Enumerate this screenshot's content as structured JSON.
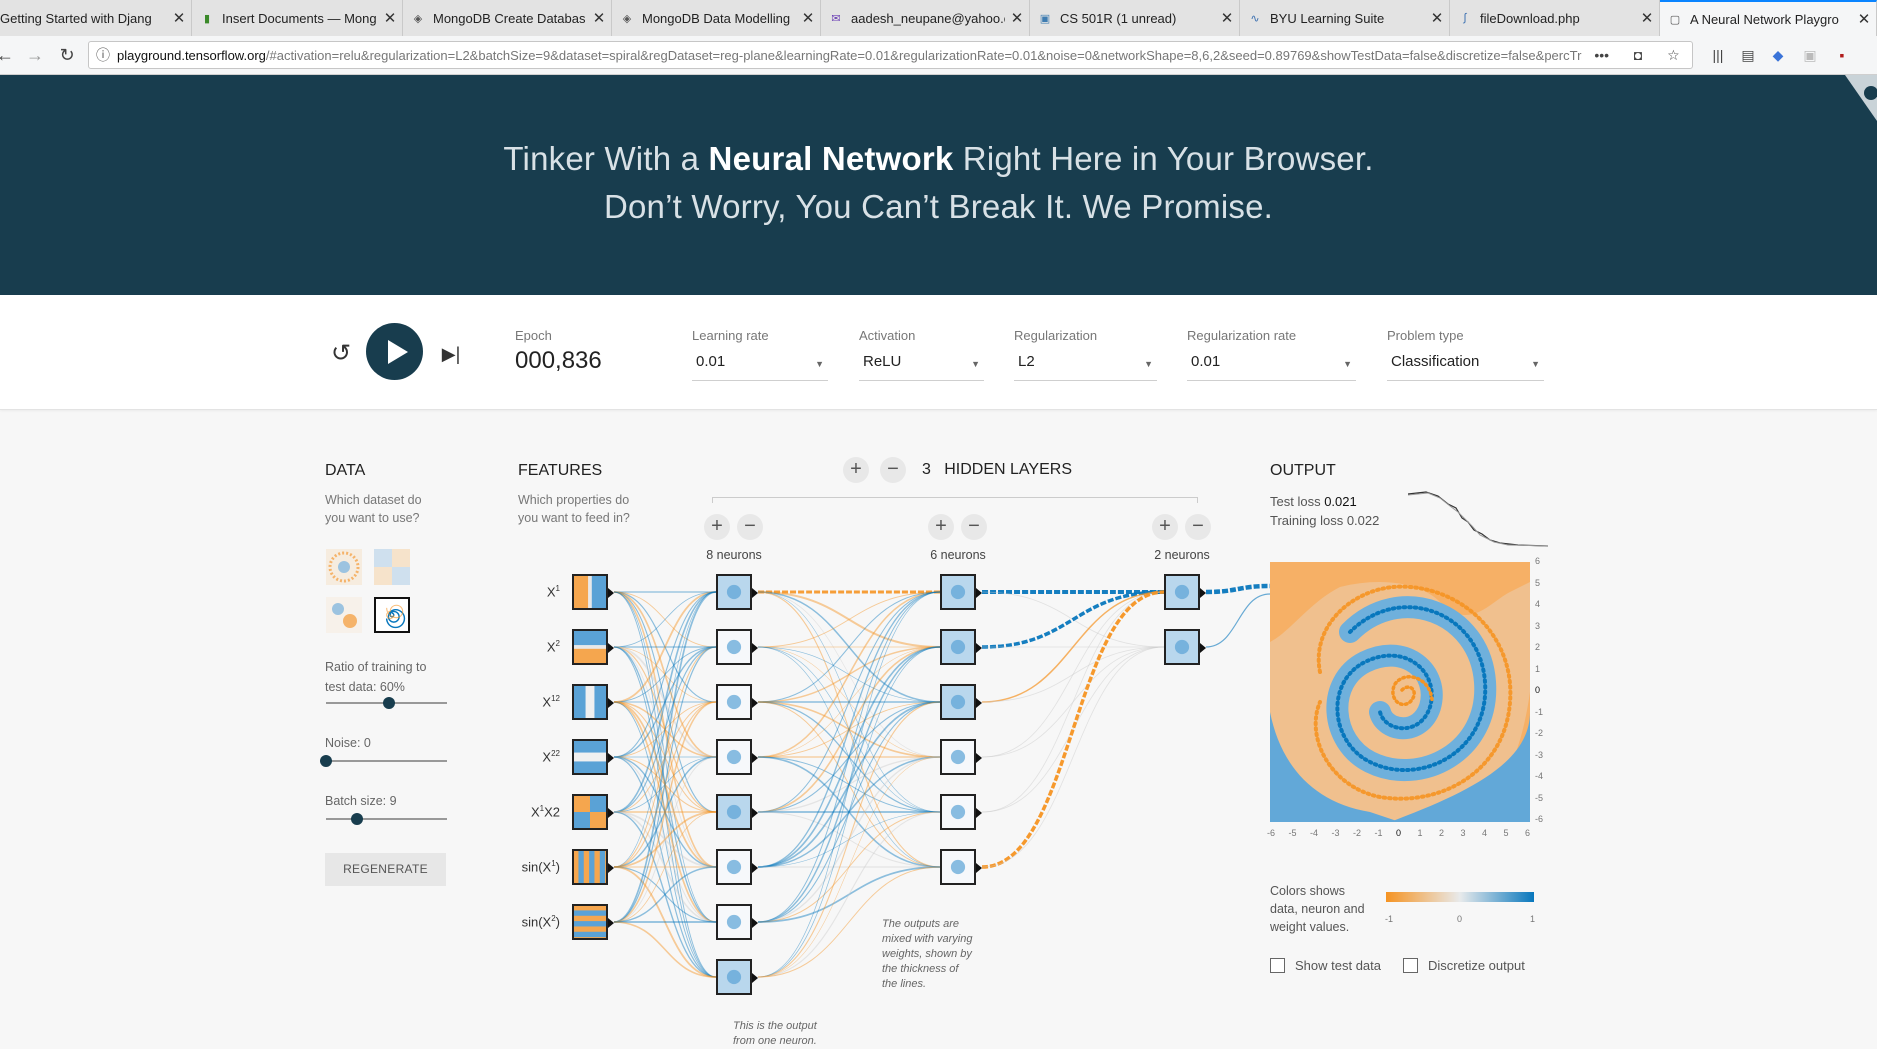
{
  "browser": {
    "tabs": [
      {
        "title": "Getting Started with Djang",
        "icon": "django-icon"
      },
      {
        "title": "Insert Documents — Mong",
        "icon": "mongodb-leaf-icon"
      },
      {
        "title": "MongoDB Create Databas",
        "icon": "diamond-icon"
      },
      {
        "title": "MongoDB Data Modelling",
        "icon": "diamond-icon"
      },
      {
        "title": "aadesh_neupane@yahoo.c",
        "icon": "mail-icon"
      },
      {
        "title": "CS 501R (1 unread)",
        "icon": "piazza-icon"
      },
      {
        "title": "BYU Learning Suite",
        "icon": "learning-suite-icon"
      },
      {
        "title": "fileDownload.php",
        "icon": "file-icon"
      },
      {
        "title": "A Neural Network Playgro",
        "icon": "tensorflow-icon"
      }
    ],
    "url_host": "playground.tensorflow.org",
    "url_rest": "/#activation=relu&regularization=L2&batchSize=9&dataset=spiral&regDataset=reg-plane&learningRate=0.01&regularizationRate=0.01&noise=0&networkShape=8,6,2&seed=0.89769&showTestData=false&discretize=false&percTrainD",
    "url_scheme_hidden": "",
    "more_label": "•••"
  },
  "header": {
    "line1_pre": "Tinker With a ",
    "line1_bold": "Neural Network",
    "line1_post": " Right Here in Your Browser.",
    "line2": "Don’t Worry, You Can’t Break It. We Promise."
  },
  "controls": {
    "epoch_label": "Epoch",
    "epoch_value": "000,836",
    "learning_rate_label": "Learning rate",
    "learning_rate_value": "0.01",
    "activation_label": "Activation",
    "activation_value": "ReLU",
    "regularization_label": "Regularization",
    "regularization_value": "L2",
    "regularization_rate_label": "Regularization rate",
    "regularization_rate_value": "0.01",
    "problem_type_label": "Problem type",
    "problem_type_value": "Classification"
  },
  "data_panel": {
    "title": "DATA",
    "desc_line1": "Which dataset do",
    "desc_line2": "you want to use?",
    "datasets": [
      "circle",
      "xor",
      "gaussian",
      "spiral"
    ],
    "selected_dataset": "spiral",
    "ratio_label_line1": "Ratio of training to",
    "ratio_label_line2": "test data:  60%",
    "ratio_value": 0.6,
    "noise_label": "Noise:  0",
    "noise_value": 0,
    "batch_label": "Batch size:  9",
    "batch_fraction": 0.26,
    "regenerate_label": "REGENERATE"
  },
  "features_panel": {
    "title": "FEATURES",
    "desc_line1": "Which properties do",
    "desc_line2": "you want to feed in?",
    "features": [
      {
        "base": "X",
        "sup": "1",
        "tail": "",
        "pattern": "x1"
      },
      {
        "base": "X",
        "sup": "2",
        "tail": "",
        "pattern": "x2"
      },
      {
        "base": "X",
        "sup": "12",
        "tail": "",
        "pattern": "x1sq"
      },
      {
        "base": "X",
        "sup": "22",
        "tail": "",
        "pattern": "x2sq"
      },
      {
        "base": "X",
        "sup": "1",
        "tail": "X2",
        "pattern": "x1x2"
      },
      {
        "base": "sin(X",
        "sup": "1",
        "tail": ")",
        "pattern": "sinx1"
      },
      {
        "base": "sin(X",
        "sup": "2",
        "tail": ")",
        "pattern": "sinx2"
      }
    ]
  },
  "network": {
    "hidden_layers_count": "3",
    "hidden_layers_label": "HIDDEN LAYERS",
    "layers": [
      {
        "neurons_label": "8 neurons",
        "neurons": 8
      },
      {
        "neurons_label": "6 neurons",
        "neurons": 6
      },
      {
        "neurons_label": "2 neurons",
        "neurons": 2
      }
    ],
    "plus_symbol": "+",
    "minus_symbol": "−",
    "note_mixed_l1": "The outputs are",
    "note_mixed_l2": "mixed with varying",
    "note_mixed_l3": "weights, shown by",
    "note_mixed_l4": "the thickness of",
    "note_mixed_l5": "the lines.",
    "note_output_l1": "This is the output",
    "note_output_l2": "from one neuron."
  },
  "output_panel": {
    "title": "OUTPUT",
    "test_loss_label": "Test loss ",
    "test_loss_value": "0.021",
    "training_loss_label": "Training loss ",
    "training_loss_value": "0.022",
    "y_ticks": [
      "6",
      "5",
      "4",
      "3",
      "2",
      "1",
      "0",
      "-1",
      "-2",
      "-3",
      "-4",
      "-5",
      "-6"
    ],
    "x_ticks": [
      "-6",
      "-5",
      "-4",
      "-3",
      "-2",
      "-1",
      "0",
      "1",
      "2",
      "3",
      "4",
      "5",
      "6"
    ],
    "legend_line1": "Colors shows",
    "legend_line2": "data, neuron and",
    "legend_line3": "weight values.",
    "legend_min": "-1",
    "legend_mid": "0",
    "legend_max": "1",
    "show_test_label": "Show test data",
    "discretize_label": "Discretize output",
    "colors": {
      "orange": "#f59322",
      "blue": "#0877bd",
      "dark": "#183d4e"
    }
  }
}
